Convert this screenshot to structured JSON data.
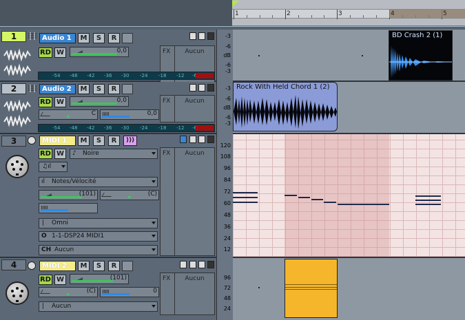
{
  "ruler": {
    "marks": [
      "1",
      "2",
      "3",
      "4",
      "5"
    ]
  },
  "tracks": [
    {
      "number": "1",
      "name": "Audio 1",
      "volume": "0,0",
      "fx_label": "FX",
      "fx_value": "Aucun",
      "scale": [
        "-3",
        "-6",
        "dB",
        "-6",
        "-3"
      ],
      "meter": [
        "-54",
        "-48",
        "-42",
        "-36",
        "-30",
        "-24",
        "-18",
        "-12",
        "-6"
      ]
    },
    {
      "number": "2",
      "name": "Audio 2",
      "volume": "0,0",
      "pan": "C",
      "volume2": "0,0",
      "fx_label": "FX",
      "fx_value": "Aucun",
      "scale": [
        "-3",
        "-6",
        "dB",
        "-6",
        "-3"
      ],
      "meter": [
        "-54",
        "-48",
        "-42",
        "-36",
        "-30",
        "-24",
        "-18",
        "-12",
        "-6"
      ]
    },
    {
      "number": "3",
      "name": "MIDI 1",
      "patch": "Noire",
      "controller": "Notes/Vélocité",
      "volume": "(101)",
      "pan": "(C)",
      "volume2": "0",
      "channel": "Omni",
      "output": "1-1-DSP24 MIDI1",
      "ch_label": "CH",
      "ch_value": "Aucun",
      "fx_label": "FX",
      "fx_value": "Aucun",
      "scale": [
        "120",
        "108",
        "96",
        "84",
        "72",
        "60",
        "48",
        "36",
        "24",
        "12"
      ]
    },
    {
      "number": "4",
      "name": "MIDI 2",
      "volume": "(101)",
      "pan": "(C)",
      "volume2": "0",
      "ch_value": "Aucun",
      "fx_label": "FX",
      "fx_value": "Aucun",
      "scale": [
        "96",
        "72",
        "48",
        "24"
      ]
    }
  ],
  "clips": {
    "crash": "BD Crash 2 (1)",
    "rock": "Rock With Held Chord 1 (2)"
  },
  "buttons": {
    "m": "M",
    "s": "S",
    "r": "R",
    "rd": "RD",
    "w": "W"
  },
  "colors": {
    "audio_name": "#3a86d3",
    "midi_name": "#f4ec8a",
    "selected_track": "#d4f565",
    "midi_clip": "#f5b62b"
  }
}
